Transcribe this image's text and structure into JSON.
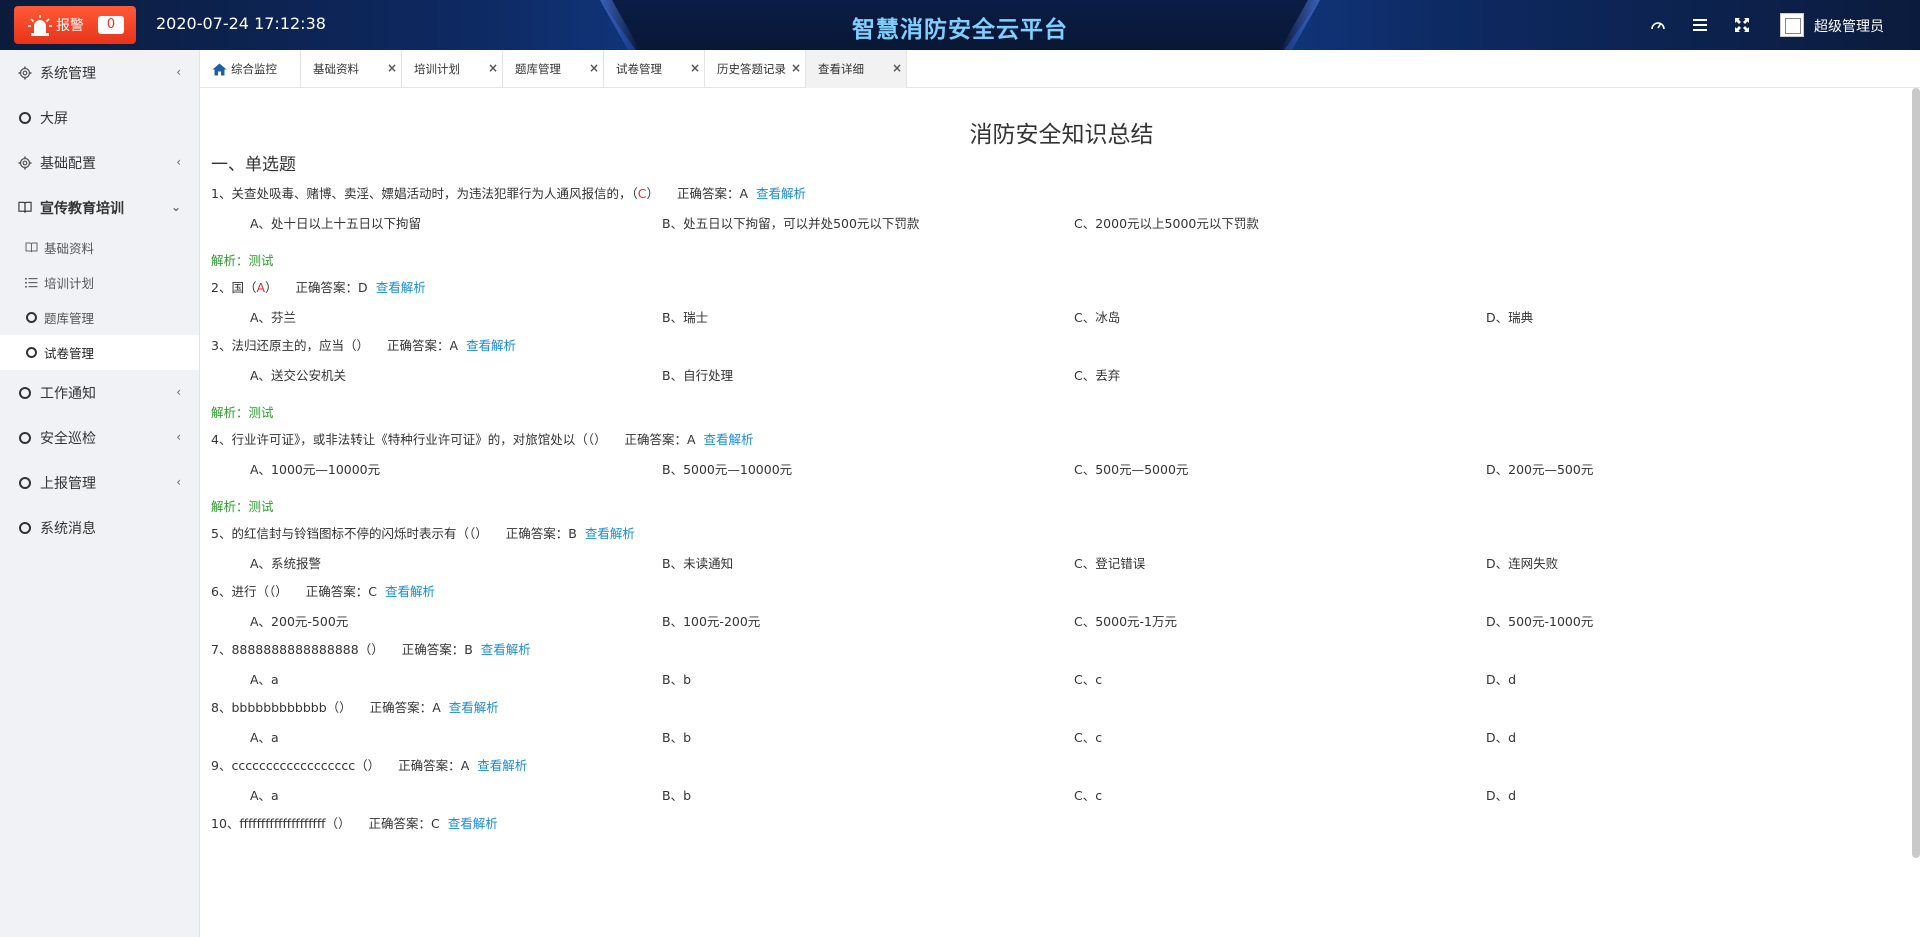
{
  "header": {
    "alarm_label": "报警",
    "alarm_count": "0",
    "datetime": "2020-07-24 17:12:38",
    "title": "智慧消防安全云平台",
    "username": "超级管理员"
  },
  "sidebar": {
    "items": [
      {
        "label": "系统管理"
      },
      {
        "label": "大屏"
      },
      {
        "label": "基础配置"
      },
      {
        "label": "宣传教育培训"
      },
      {
        "label": "工作通知"
      },
      {
        "label": "安全巡检"
      },
      {
        "label": "上报管理"
      },
      {
        "label": "系统消息"
      }
    ],
    "sub_items": [
      {
        "label": "基础资料"
      },
      {
        "label": "培训计划"
      },
      {
        "label": "题库管理"
      },
      {
        "label": "试卷管理"
      }
    ]
  },
  "tabs": [
    {
      "label": "综合监控"
    },
    {
      "label": "基础资料"
    },
    {
      "label": "培训计划"
    },
    {
      "label": "题库管理"
    },
    {
      "label": "试卷管理"
    },
    {
      "label": "历史答题记录"
    },
    {
      "label": "查看详细"
    }
  ],
  "paper": {
    "title": "消防安全知识总结",
    "section": "一、单选题",
    "answer_prefix": "正确答案：",
    "view_label": "查看解析",
    "questions": [
      {
        "stem": "1、关查处吸毒、赌博、卖淫、嫖娼活动时，为违法犯罪行为人通风报信的，（",
        "mine": "C",
        "stem_end": "）",
        "answer": "A",
        "options": [
          "A、处十日以上十五日以下拘留",
          "B、处五日以下拘留，可以并处500元以下罚款",
          "C、2000元以上5000元以下罚款"
        ],
        "analysis": "解析：测试"
      },
      {
        "stem": "2、国（",
        "mine": "A",
        "stem_end": "）",
        "answer": "D",
        "options": [
          "A、芬兰",
          "B、瑞士",
          "C、冰岛",
          "D、瑞典"
        ],
        "analysis": ""
      },
      {
        "stem": "3、法归还原主的，应当（）",
        "mine": "",
        "stem_end": "",
        "answer": "A",
        "options": [
          "A、送交公安机关",
          "B、自行处理",
          "C、丢弃"
        ],
        "analysis": "解析：测试"
      },
      {
        "stem": "4、行业许可证》，或非法转让《特种行业许可证》的，对旅馆处以（（）",
        "mine": "",
        "stem_end": "",
        "answer": "A",
        "options": [
          "A、1000元—10000元",
          "B、5000元—10000元",
          "C、500元—5000元",
          "D、200元—500元"
        ],
        "analysis": "解析：测试"
      },
      {
        "stem": "5、的红信封与铃铛图标不停的闪烁时表示有（（）",
        "mine": "",
        "stem_end": "",
        "answer": "B",
        "options": [
          "A、系统报警",
          "B、未读通知",
          "C、登记错误",
          "D、连网失败"
        ],
        "analysis": ""
      },
      {
        "stem": "6、进行（（）",
        "mine": "",
        "stem_end": "",
        "answer": "C",
        "options": [
          "A、200元-500元",
          "B、100元-200元",
          "C、5000元-1万元",
          "D、500元-1000元"
        ],
        "analysis": ""
      },
      {
        "stem": "7、8888888888888888（）",
        "mine": "",
        "stem_end": "",
        "answer": "B",
        "options": [
          "A、a",
          "B、b",
          "C、c",
          "D、d"
        ],
        "analysis": ""
      },
      {
        "stem": "8、bbbbbbbbbbbb（）",
        "mine": "",
        "stem_end": "",
        "answer": "A",
        "options": [
          "A、a",
          "B、b",
          "C、c",
          "D、d"
        ],
        "analysis": ""
      },
      {
        "stem": "9、cccccccccccccccccc（）",
        "mine": "",
        "stem_end": "",
        "answer": "A",
        "options": [
          "A、a",
          "B、b",
          "C、c",
          "D、d"
        ],
        "analysis": ""
      },
      {
        "stem": "10、ffffffffffffffffffff（）",
        "mine": "",
        "stem_end": "",
        "answer": "C",
        "options": [],
        "analysis": ""
      }
    ]
  },
  "colors": {
    "header_bg": "#0e2a63",
    "title_color": "#7fd0ff",
    "alarm_red": "#e8341b",
    "link_blue": "#1a8cd8",
    "analysis_green": "#2e9e2e",
    "mine_red": "#e02b2b"
  },
  "icons": {
    "alarm": "alarm-siren-icon",
    "dashboard": "dashboard-gauge-icon",
    "menu": "menu-bars-icon",
    "fullscreen": "fullscreen-icon",
    "gear": "gear-icon",
    "circle": "circle-icon",
    "book": "book-icon",
    "list": "list-icon",
    "home": "home-icon"
  }
}
